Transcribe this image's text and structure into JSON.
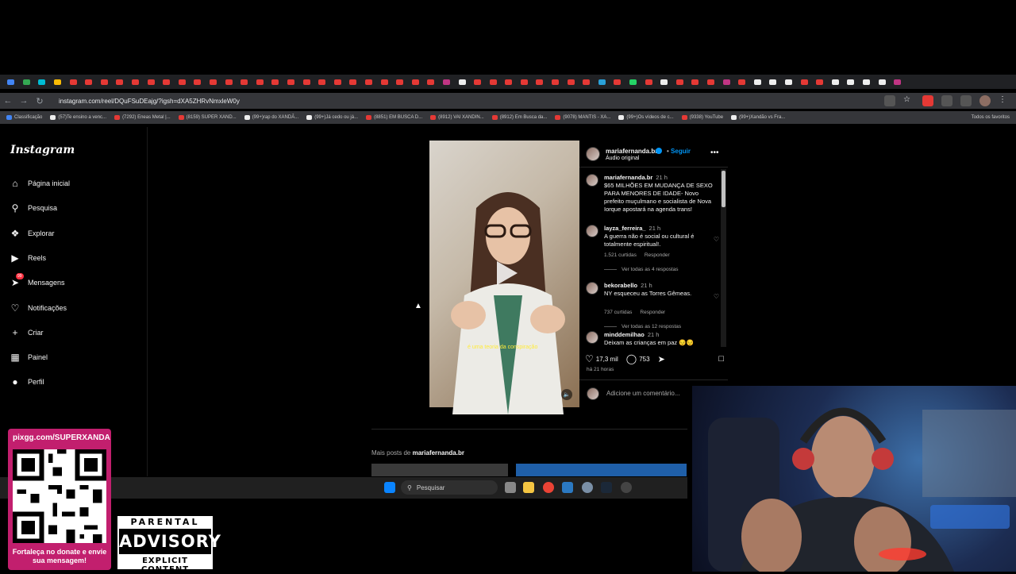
{
  "browser": {
    "url": "instagram.com/reel/DQuFSuDEajg/?igsh=dXA5ZHRvNmxleW0y",
    "tab_favicon_colors": [
      "#4285f4",
      "#34a853",
      "#00bcd4",
      "#fbbc05",
      "#e53935",
      "#e53935",
      "#e53935",
      "#e53935",
      "#e53935",
      "#e53935",
      "#e53935",
      "#e53935",
      "#e53935",
      "#e53935",
      "#e53935",
      "#e53935",
      "#e53935",
      "#e53935",
      "#e53935",
      "#e53935",
      "#e53935",
      "#e53935",
      "#e53935",
      "#e53935",
      "#e53935",
      "#e53935",
      "#e53935",
      "#e53935",
      "#c13584",
      "#eeeeee",
      "#e53935",
      "#e53935",
      "#e53935",
      "#e53935",
      "#e53935",
      "#e53935",
      "#e53935",
      "#e53935",
      "#2aa1d9",
      "#e53935",
      "#25d366",
      "#e53935",
      "#eeeeee",
      "#e53935",
      "#e53935",
      "#e53935",
      "#c13584",
      "#e53935",
      "#eeeeee",
      "#eeeeee",
      "#eeeeee",
      "#e53935",
      "#e53935",
      "#eeeeee",
      "#eeeeee",
      "#eeeeee",
      "#eeeeee",
      "#c13584"
    ],
    "bookmarks": [
      {
        "label": "Classificação",
        "color": "#4285f4"
      },
      {
        "label": "(57)Te ensino a venc...",
        "color": "#eeeeee"
      },
      {
        "label": "(7292) Eneas Metal |...",
        "color": "#e53935"
      },
      {
        "label": "(8159) SUPER XAND...",
        "color": "#e53935"
      },
      {
        "label": "(99+)rap do XANDÃ...",
        "color": "#eeeeee"
      },
      {
        "label": "(99+)Já cedo ou já...",
        "color": "#eeeeee"
      },
      {
        "label": "(8851) EM BUSCA D...",
        "color": "#e53935"
      },
      {
        "label": "(8912) VAI XANDIN...",
        "color": "#e53935"
      },
      {
        "label": "(8912) Em Busca da...",
        "color": "#e53935"
      },
      {
        "label": "(9078) MANTIS - XA...",
        "color": "#e53935"
      },
      {
        "label": "(99+)Os vídeos de c...",
        "color": "#eeeeee"
      },
      {
        "label": "(9338) YouTube",
        "color": "#e53935"
      },
      {
        "label": "(99+)Xandão vs Fra...",
        "color": "#eeeeee"
      }
    ],
    "all_bookmarks": "Todos os favoritos"
  },
  "instagram": {
    "logo": "Instagram",
    "nav": [
      {
        "label": "Página inicial",
        "icon": "home-icon"
      },
      {
        "label": "Pesquisa",
        "icon": "search-icon"
      },
      {
        "label": "Explorar",
        "icon": "compass-icon"
      },
      {
        "label": "Reels",
        "icon": "reels-icon"
      },
      {
        "label": "Mensagens",
        "icon": "messages-icon",
        "badge": "99"
      },
      {
        "label": "Notificações",
        "icon": "heart-icon"
      },
      {
        "label": "Criar",
        "icon": "plus-icon"
      },
      {
        "label": "Painel",
        "icon": "dashboard-icon"
      },
      {
        "label": "Perfil",
        "icon": "profile-icon"
      }
    ],
    "post": {
      "author": "mariafernanda.br",
      "follow": "Seguir",
      "audio": "Áudio original",
      "video_caption": "é uma teoria da conspiração",
      "comments": [
        {
          "user": "mariafernanda.br",
          "time": "21 h",
          "text": "$65 MILHÕES EM MUDANÇA DE SEXO PARA MENORES DE IDADE- Novo prefeito muçulmano e socialista de Nova Iorque apostará na agenda trans!"
        },
        {
          "user": "layza_ferreira_",
          "time": "21 h",
          "text": "A guerra não é social ou cultural é totalmente espiritual!.",
          "likes": "1.521 curtidas",
          "reply": "Responder",
          "replies": "Ver todas as 4 respostas"
        },
        {
          "user": "bekorabello",
          "time": "21 h",
          "text": "NY esqueceu as Torres Gêmeas.",
          "likes": "737 curtidas",
          "reply": "Responder",
          "replies": "Ver todas as 12 respostas"
        },
        {
          "user": "minddemilhao",
          "time": "21 h",
          "text": "Deixam as crianças em paz 😔😔"
        }
      ],
      "likes": "17,3 mil",
      "comment_count": "753",
      "posted": "há 21 horas",
      "add_comment_placeholder": "Adicione um comentário...",
      "more_posts_prefix": "Mais posts de",
      "more_posts_user": "mariafernanda.br"
    }
  },
  "taskbar": {
    "search_placeholder": "Pesquisar"
  },
  "overlay": {
    "qr_title": "pixgg.com/SUPERXANDA",
    "qr_message": "Fortaleça no donate e envie sua mensagem!",
    "advisory_top": "PARENTAL",
    "advisory_mid": "ADVISORY",
    "advisory_bottom": "EXPLICIT CONTENT"
  }
}
